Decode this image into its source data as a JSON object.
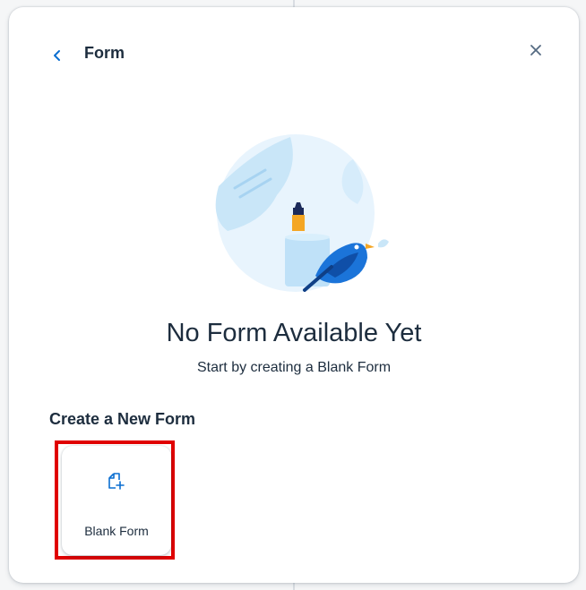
{
  "dialog": {
    "title": "Form",
    "back_icon": "chevron-left-icon",
    "close_icon": "close-icon"
  },
  "empty_state": {
    "illustration": "bird-with-note-illustration",
    "title": "No Form Available Yet",
    "subtitle": "Start by creating a Blank Form"
  },
  "create_section": {
    "title": "Create a New Form",
    "tiles": [
      {
        "label": "Blank Form",
        "icon": "add-document-icon"
      }
    ]
  },
  "colors": {
    "accent": "#0a6ed1",
    "text": "#1d2d3e",
    "highlight": "#e00000"
  }
}
